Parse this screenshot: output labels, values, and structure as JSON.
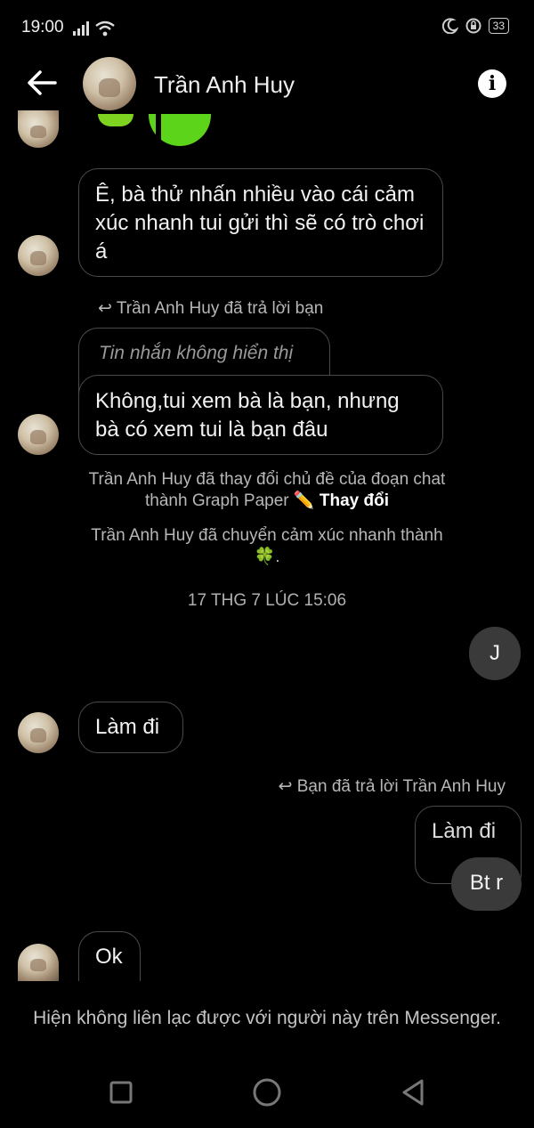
{
  "status": {
    "time": "19:00",
    "battery": "33"
  },
  "header": {
    "contact_name": "Trần Anh Huy"
  },
  "messages": {
    "m1": "Ê, bà thử nhấn nhiều vào cái cảm xúc nhanh tui gửi thì sẽ có trò chơi á",
    "reply_note_1": "Trần Anh Huy đã trả lời bạn",
    "hidden_message": "Tin nhắn không hiển thị",
    "m2": "Không,tui xem bà là bạn, nhưng bà có xem tui là bạn đâu",
    "theme_notice": "Trần Anh Huy đã thay đổi chủ đề của đoạn chat thành Graph Paper",
    "theme_action": "Thay đổi",
    "emoji_notice": "Trần Anh Huy đã chuyển cảm xúc nhanh thành",
    "emoji_clover": "🍀",
    "timestamp": "17 THG 7 LÚC 15:06",
    "sent_j": "J",
    "m3": "Làm đi",
    "reply_note_2": "Bạn đã trả lời Trần Anh Huy",
    "quoted": "Làm đi",
    "sent_bt": "Bt r",
    "m4": "Ok"
  },
  "footer": {
    "unavailable": "Hiện không liên lạc được với người này trên Messenger."
  }
}
